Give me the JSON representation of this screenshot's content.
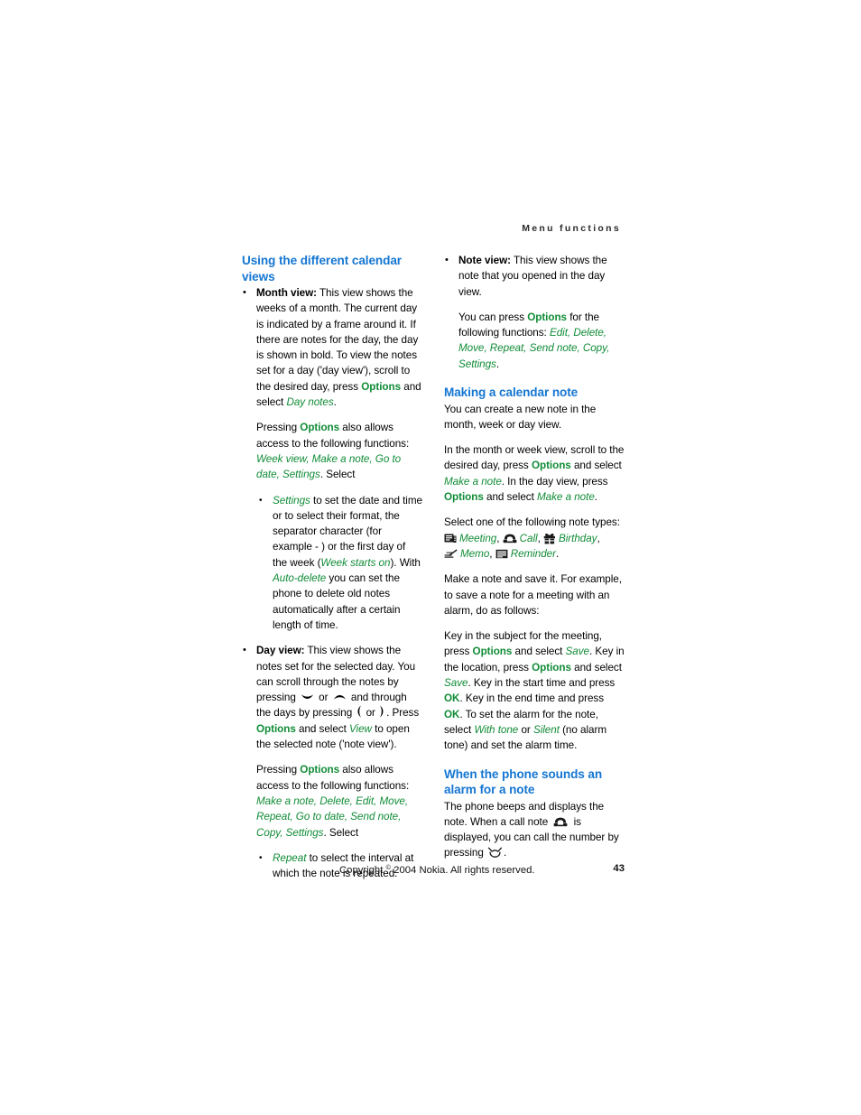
{
  "page": {
    "running_head": "Menu functions",
    "footer_copyright_pre": "Copyright ",
    "footer_copyright_mark": "©",
    "footer_copyright_post": " 2004 Nokia. All rights reserved.",
    "page_number": "43",
    "colors": {
      "heading_blue": "#1476d2",
      "ui_green": "#118c37",
      "body_black": "#000000",
      "running_head_gray": "#2b2b2b"
    }
  },
  "left_column": {
    "heading": "Using the different calendar views",
    "month_view": {
      "label": "Month view:",
      "body": " This view shows the weeks of a month. The current day is indicated by a frame around it. If there are notes for the day, the day is shown in bold. To view the notes set for a day ('day view'), scroll to the desired day, press ",
      "options_1": "Options",
      "body_2": " and select ",
      "day_notes": "Day notes",
      "body_3": ".",
      "para2_pre": "Pressing ",
      "para2_options": "Options",
      "para2_mid": " also allows access to the following functions: ",
      "para2_func_1": "Week view",
      "para2_func_2": "Make a note",
      "para2_func_3": "Go to date",
      "para2_func_4": "Settings",
      "para2_tail": ". Select",
      "settings_bullet": {
        "term": "Settings",
        "body_1": " to set the date and time or to select their format, the separator character (for example - ) or the first day of the week (",
        "week_starts_on": "Week starts on",
        "body_2": "). With ",
        "auto_delete": "Auto-delete",
        "body_3": " you can set the phone to delete old notes automatically after a certain length of time."
      }
    },
    "day_view": {
      "label": "Day view:",
      "body_1": " This view shows the notes set for the selected day. You can scroll through the notes by pressing ",
      "or_1": " or ",
      "body_2": " and through the days by pressing ",
      "or_2": " or ",
      "body_3": ". Press ",
      "options_1": "Options",
      "body_4": " and select ",
      "view_term": "View",
      "body_5": " to open the selected note ('note view').",
      "para2_pre": "Pressing ",
      "para2_options": "Options",
      "para2_mid": " also allows access to the following functions: ",
      "para2_func_1": "Make a note",
      "para2_func_2": "Delete",
      "para2_func_3": "Edit",
      "para2_func_4": "Move",
      "para2_func_5": "Repeat",
      "para2_func_6": "Go to date",
      "para2_func_7": "Send note",
      "para2_func_8": "Copy",
      "para2_func_9": "Settings",
      "para2_tail": ". Select",
      "repeat_bullet": {
        "term": "Repeat",
        "body": " to select the interval at which the note is repeated."
      }
    }
  },
  "right_column": {
    "note_view": {
      "label": "Note view:",
      "body_1": " This view shows the note that you opened in the day view.",
      "para2_pre": "You can press ",
      "para2_options": "Options",
      "para2_mid": " for the following functions: ",
      "func_1": "Edit",
      "func_2": "Delete",
      "func_3": "Move",
      "func_4": "Repeat",
      "func_5": "Send note",
      "func_6": "Copy",
      "func_7": "Settings",
      "para2_tail": "."
    },
    "making_note": {
      "heading": "Making a calendar note",
      "para1": "You can create a new note in the month, week or day view.",
      "para2_pre": "In the month or week view, scroll to the desired day, press ",
      "para2_options_1": "Options",
      "para2_mid_1": " and select ",
      "para2_make_note_1": "Make a note",
      "para2_mid_2": ". In the day view, press ",
      "para2_options_2": "Options",
      "para2_mid_3": " and select ",
      "para2_make_note_2": "Make a note",
      "para2_tail": ".",
      "types_intro": "Select one of the following note types:",
      "types": [
        {
          "icon": "meeting-icon",
          "label": "Meeting",
          "sep": ","
        },
        {
          "icon": "call-icon",
          "label": "Call",
          "sep": ","
        },
        {
          "icon": "birthday-icon",
          "label": "Birthday",
          "sep": ","
        },
        {
          "icon": "memo-icon",
          "label": "Memo",
          "sep": ","
        },
        {
          "icon": "reminder-icon",
          "label": "Reminder",
          "sep": "."
        }
      ],
      "para4": "Make a note and save it. For example, to save a note for a meeting with an alarm, do as follows:",
      "steps": {
        "s1": "Key in the subject for the meeting, press ",
        "opt_1": "Options",
        "s2": " and select ",
        "save_1": "Save",
        "s3": ". Key in the location, press ",
        "opt_2": "Options",
        "s4": " and select ",
        "save_2": "Save",
        "s5": ". Key in the start time and press ",
        "ok_1": "OK",
        "s6": ". Key in the end time and press ",
        "ok_2": "OK",
        "s7": ". To set the alarm for the note, select ",
        "with_tone": "With tone",
        "s8": " or ",
        "silent": "Silent",
        "s9": " (no alarm tone) and set the alarm time."
      }
    },
    "alarm_section": {
      "heading": "When the phone sounds an alarm for a note",
      "body_1": "The phone beeps and displays the note. When a call note ",
      "body_2": " is displayed, you can call the number by pressing ",
      "body_3": "."
    }
  }
}
